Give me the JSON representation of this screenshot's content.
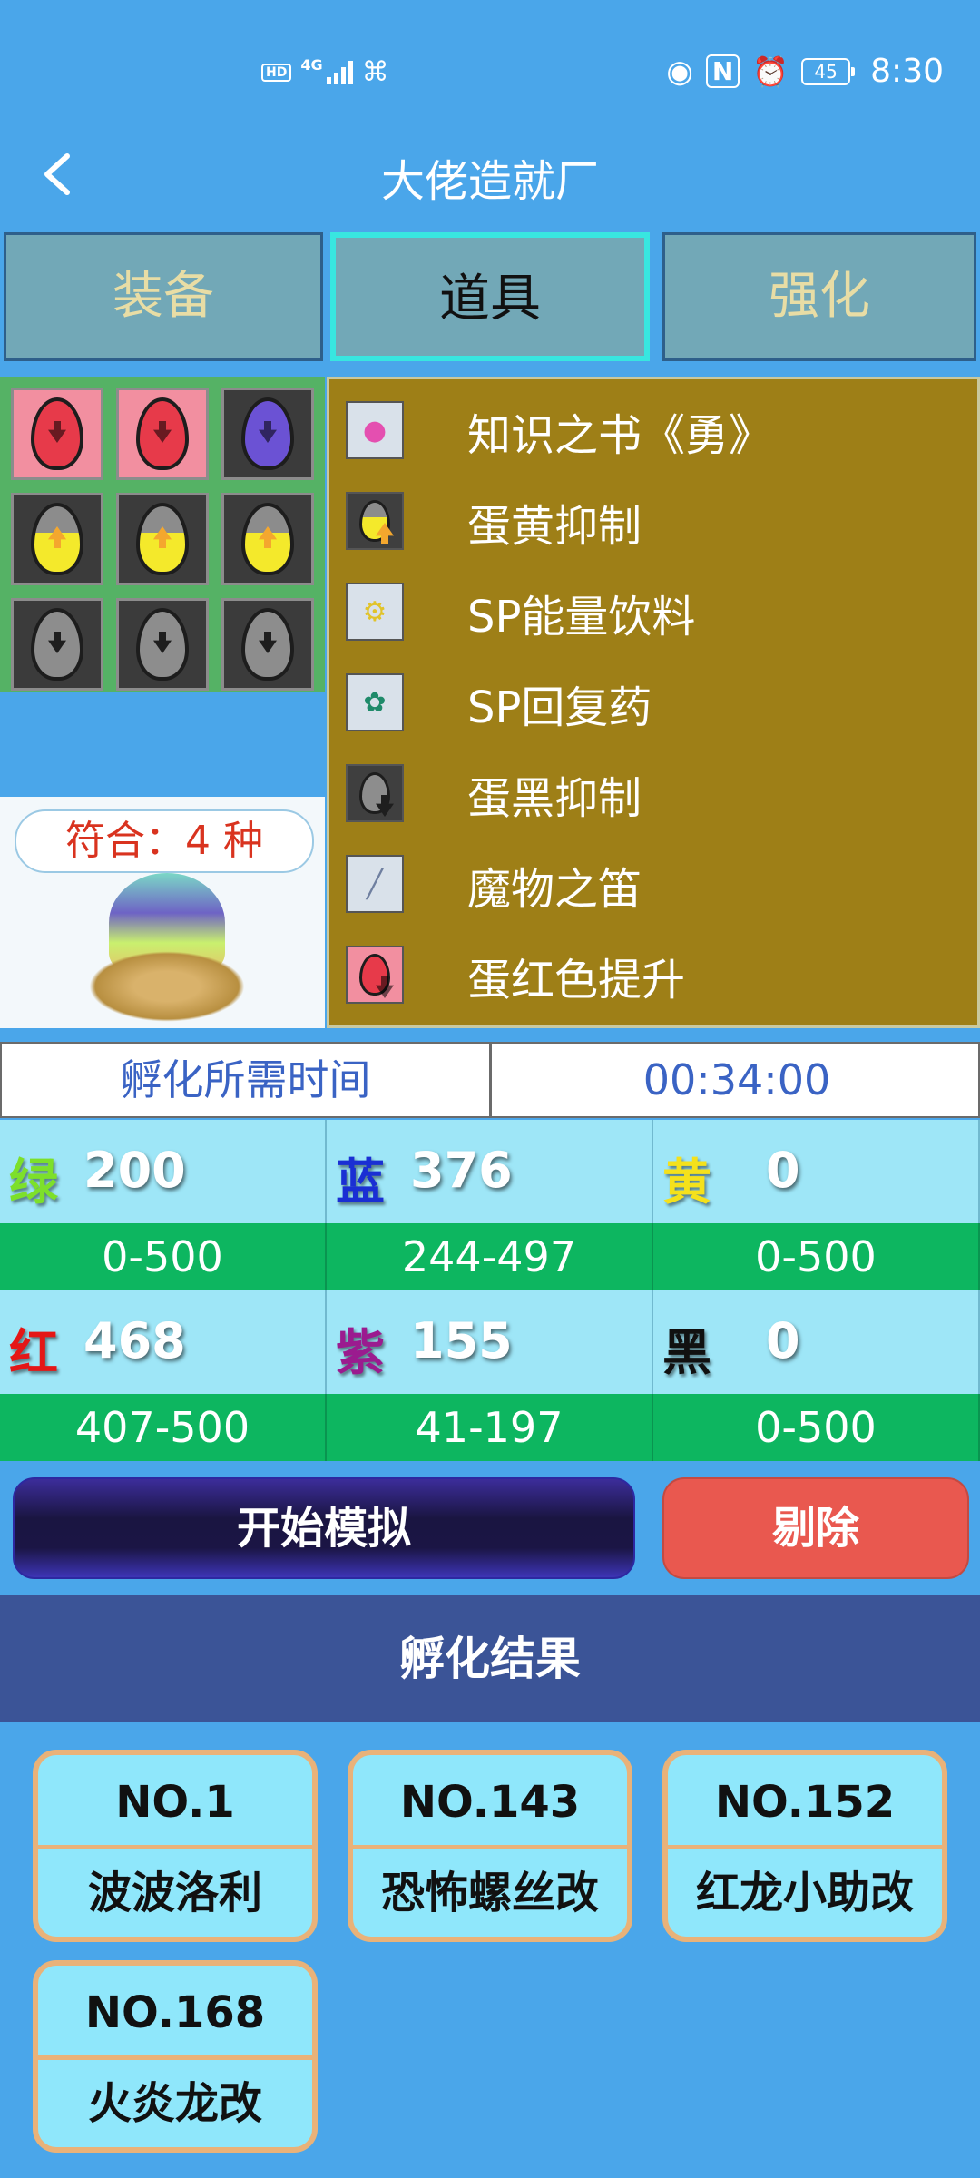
{
  "status": {
    "hd": "HD",
    "network": "4G",
    "battery": "45",
    "time": "8:30"
  },
  "header": {
    "back_icon": "chevron-left-icon",
    "title": "大佬造就厂"
  },
  "tabs": [
    {
      "label": "装备",
      "active": false
    },
    {
      "label": "道具",
      "active": true
    },
    {
      "label": "强化",
      "active": false
    }
  ],
  "egg_grid": [
    {
      "color": "red"
    },
    {
      "color": "red"
    },
    {
      "color": "purple"
    },
    {
      "color": "yellow"
    },
    {
      "color": "yellow"
    },
    {
      "color": "yellow"
    },
    {
      "color": "gray"
    },
    {
      "color": "gray"
    },
    {
      "color": "gray"
    }
  ],
  "match": {
    "label": "符合：4 种"
  },
  "items": [
    {
      "name": "知识之书《勇》",
      "icon": "book-icon"
    },
    {
      "name": "蛋黄抑制",
      "icon": "yellow-egg-icon"
    },
    {
      "name": "SP能量饮料",
      "icon": "potion-bottle-icon"
    },
    {
      "name": "SP回复药",
      "icon": "herb-icon"
    },
    {
      "name": "蛋黑抑制",
      "icon": "gray-egg-icon"
    },
    {
      "name": "魔物之笛",
      "icon": "flute-icon"
    },
    {
      "name": "蛋红色提升",
      "icon": "red-egg-icon"
    }
  ],
  "hatch": {
    "label": "孵化所需时间",
    "value": "00:34:00"
  },
  "stats": [
    {
      "char": "绿",
      "value": "200",
      "range": "0-500",
      "color": "#7de02a"
    },
    {
      "char": "蓝",
      "value": "376",
      "range": "244-497",
      "color": "#1a2fd4"
    },
    {
      "char": "黄",
      "value": "0",
      "range": "0-500",
      "color": "#f5e11b"
    },
    {
      "char": "红",
      "value": "468",
      "range": "407-500",
      "color": "#e51616"
    },
    {
      "char": "紫",
      "value": "155",
      "range": "41-197",
      "color": "#9b1b8f"
    },
    {
      "char": "黑",
      "value": "0",
      "range": "0-500",
      "color": "#111111"
    }
  ],
  "actions": {
    "simulate": "开始模拟",
    "remove": "剔除"
  },
  "results": {
    "title": "孵化结果",
    "cards": [
      {
        "no": "NO.1",
        "name": "波波洛利"
      },
      {
        "no": "NO.143",
        "name": "恐怖螺丝改"
      },
      {
        "no": "NO.152",
        "name": "红龙小助改"
      },
      {
        "no": "NO.168",
        "name": "火炎龙改"
      }
    ]
  }
}
